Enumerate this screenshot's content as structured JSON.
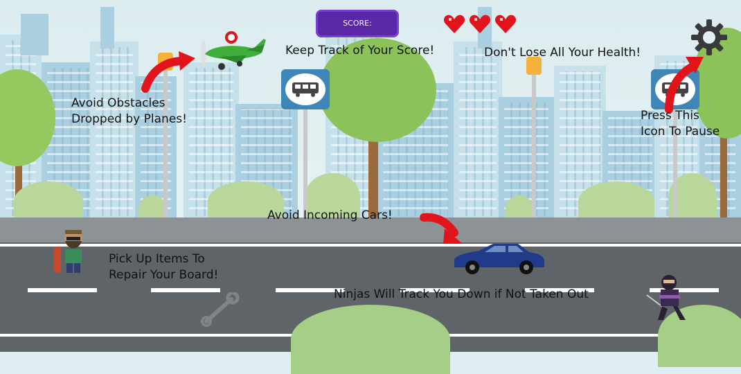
{
  "hud": {
    "score_label": "SCORE:",
    "hearts": 3,
    "settings_icon": "gear-icon"
  },
  "tips": {
    "score": "Keep Track of Your Score!",
    "health": "Don't Lose All Your Health!",
    "planes": "Avoid Obstacles\nDropped by Planes!",
    "pause": "Press This\nIcon To Pause",
    "cars": "Avoid Incoming Cars!",
    "items": "Pick Up Items To\nRepair Your Board!",
    "ninjas": "Ninjas Will Track You Down if Not Taken Out"
  },
  "colors": {
    "score_box": "#5a27a6",
    "heart": "#e1141e",
    "arrow": "#e0141a",
    "car": "#1f3b8a",
    "plane": "#3fae3c"
  },
  "sprites": [
    "plane-sprite",
    "car-sprite",
    "player-sprite",
    "ninja-sprite",
    "wrench-item",
    "bus-stop-sign"
  ]
}
